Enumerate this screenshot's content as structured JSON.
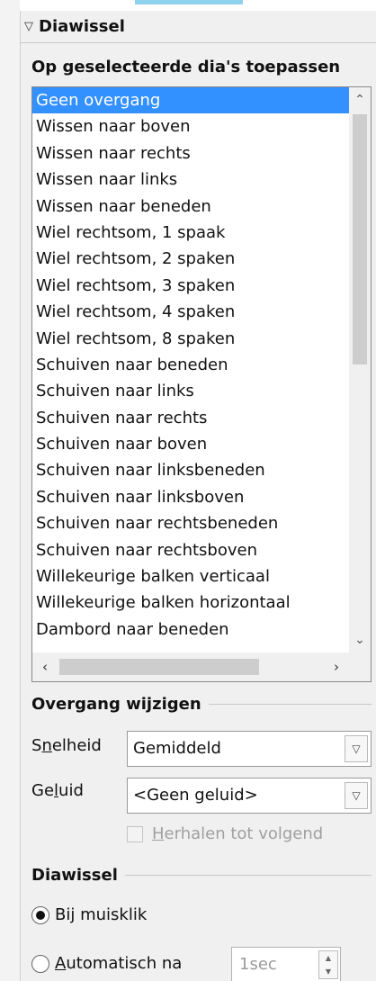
{
  "deck": {
    "title": "Diawissel",
    "section_title": "Op geselecteerde dia's toepassen"
  },
  "transitions": {
    "items": [
      "Geen overgang",
      "Wissen naar boven",
      "Wissen naar rechts",
      "Wissen naar links",
      "Wissen naar beneden",
      "Wiel rechtsom, 1 spaak",
      "Wiel rechtsom, 2 spaken",
      "Wiel rechtsom, 3 spaken",
      "Wiel rechtsom, 4 spaken",
      "Wiel rechtsom, 8 spaken",
      "Schuiven naar beneden",
      "Schuiven naar links",
      "Schuiven naar rechts",
      "Schuiven naar boven",
      "Schuiven naar linksbeneden",
      "Schuiven naar linksboven",
      "Schuiven naar rechtsbeneden",
      "Schuiven naar rechtsboven",
      "Willekeurige balken verticaal",
      "Willekeurige balken horizontaal",
      "Dambord naar beneden"
    ],
    "selected": "Geen overgang"
  },
  "modify": {
    "heading": "Overgang wijzigen",
    "speed_label_pre": "S",
    "speed_label_u": "n",
    "speed_label_post": "elheid",
    "speed_value": "Gemiddeld",
    "sound_label_pre": "Ge",
    "sound_label_u": "l",
    "sound_label_post": "uid",
    "sound_value": "<Geen geluid>",
    "loop_label_u": "H",
    "loop_label_post": "erhalen tot volgend",
    "loop_enabled": false
  },
  "advance": {
    "heading": "Diawissel",
    "on_click": "Bij muisklik",
    "auto_label_u": "A",
    "auto_label_post": "utomatisch na",
    "auto_value": "1sec",
    "selected": "on_click"
  },
  "icons": {
    "collapse": "triangle-down-icon",
    "scroll_up": "chevron-up-icon",
    "scroll_down": "chevron-down-icon",
    "scroll_left": "chevron-left-icon",
    "scroll_right": "chevron-right-icon",
    "dropdown": "chevron-down-icon"
  },
  "colors": {
    "selection": "#3390ff",
    "accent": "#8fd2ee"
  }
}
